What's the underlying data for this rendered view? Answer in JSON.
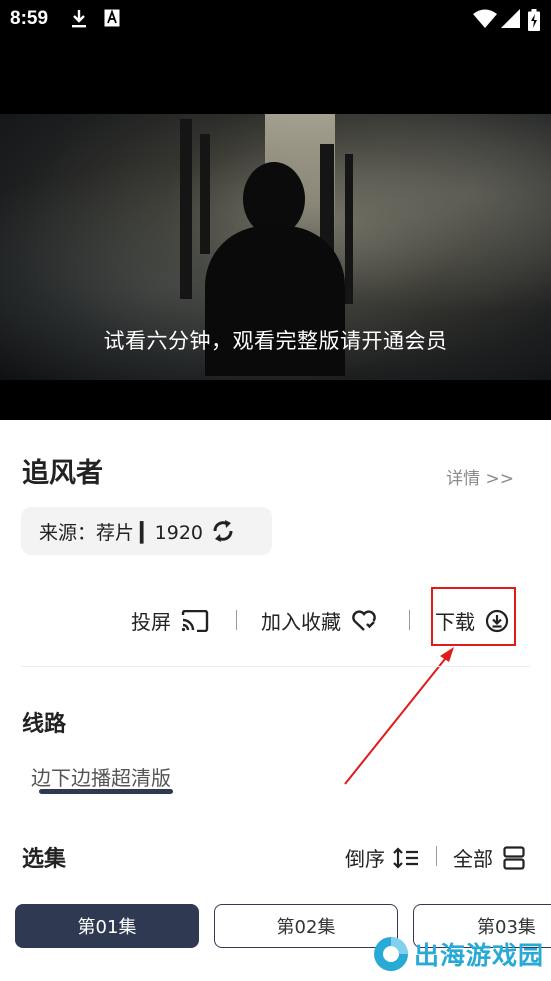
{
  "status_bar": {
    "time": "8:59",
    "icons": [
      "download-icon",
      "a-icon",
      "wifi-icon",
      "signal-icon",
      "battery-icon"
    ]
  },
  "player": {
    "subtitle": "试看六分钟，观看完整版请开通会员"
  },
  "info": {
    "title": "追风者",
    "detail_link": "详情 >>",
    "source": "来源：荐片 ▎1920"
  },
  "actions": {
    "cast": "投屏",
    "favorite": "加入收藏",
    "download": "下载"
  },
  "route": {
    "section_title": "线路",
    "tab": "边下边播超清版"
  },
  "episodes": {
    "section_title": "选集",
    "order_label": "倒序",
    "all_label": "全部",
    "items": [
      "第01集",
      "第02集",
      "第03集"
    ]
  },
  "watermark": {
    "text": "出海游戏园"
  },
  "colors": {
    "accent": "#2f3a52",
    "highlight": "#e01b1b",
    "watermark": "#29a9d6"
  }
}
